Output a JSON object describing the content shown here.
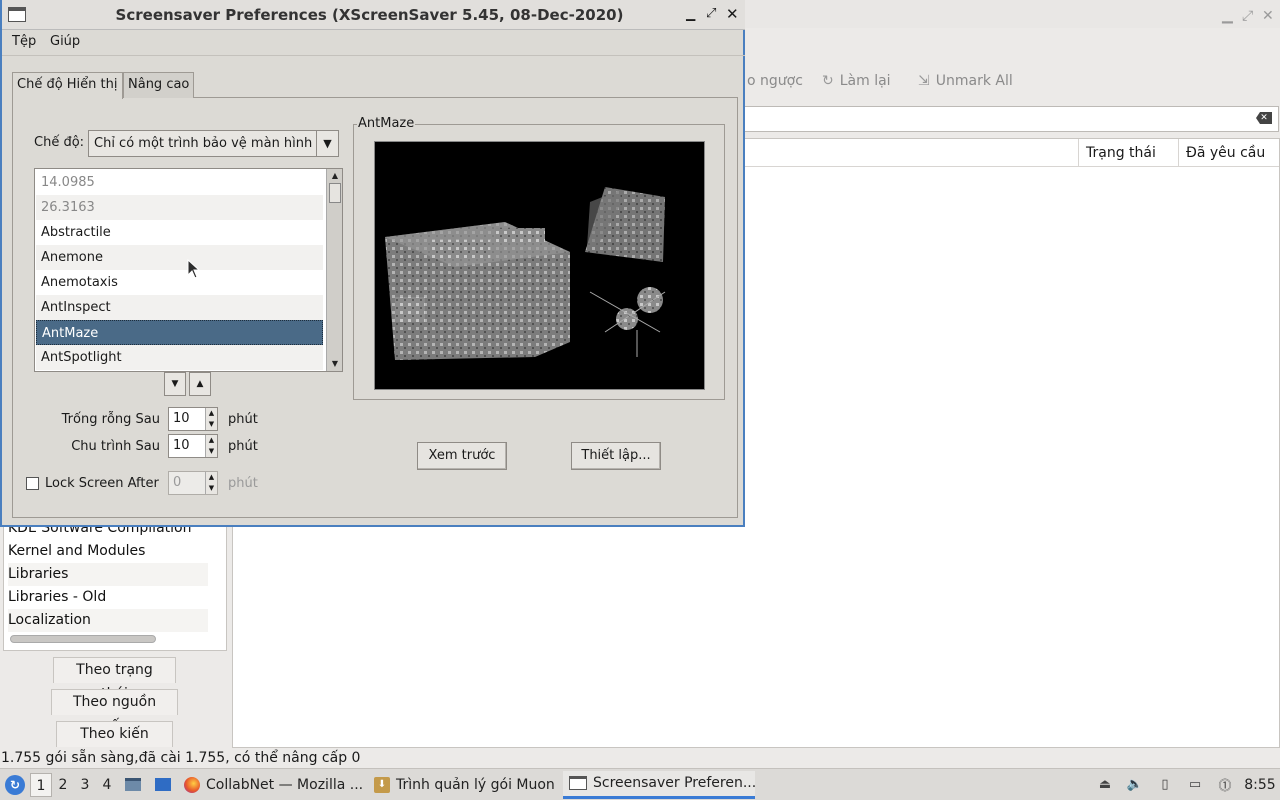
{
  "background_app": {
    "toolbar": {
      "undo_label": "o ngược",
      "redo_label": "Làm lại",
      "unmark_label": "Unmark All"
    },
    "table_headers": {
      "status": "Trạng thái",
      "requested": "Đã yêu cầu"
    },
    "categories": [
      "KDE Software Compilation",
      "Kernel and Modules",
      "Libraries",
      "Libraries - Old",
      "Localization"
    ],
    "filters": {
      "by_status": "Theo trạng thái",
      "by_origin": "Theo nguồn gốc",
      "by_arch": "Theo kiến trúc"
    },
    "status_text": "1.755 gói sẵn sàng,đã cài 1.755, có thể nâng cấp 0"
  },
  "dialog": {
    "title": "Screensaver Preferences  (XScreenSaver 5.45, 08-Dec-2020)",
    "menu": {
      "file": "Tệp",
      "help": "Giúp"
    },
    "tabs": {
      "display": "Chế độ Hiển thị",
      "advanced": "Nâng cao"
    },
    "mode_label": "Chế độ:",
    "mode_value": "Chỉ có một trình bảo vệ màn hình",
    "savers": [
      "14.0985",
      "26.3163",
      "Abstractile",
      "Anemone",
      "Anemotaxis",
      "AntInspect",
      "AntMaze",
      "AntSpotlight"
    ],
    "selected_saver": "AntMaze",
    "blank_after_label": "Trống rỗng Sau",
    "blank_after_value": "10",
    "cycle_after_label": "Chu trình Sau",
    "cycle_after_value": "10",
    "lock_label": "Lock Screen After",
    "lock_value": "0",
    "unit": "phút",
    "preview_title": "AntMaze",
    "preview_button": "Xem trước",
    "settings_button": "Thiết lập..."
  },
  "taskbar": {
    "workspaces": [
      "1",
      "2",
      "3",
      "4"
    ],
    "tasks": {
      "firefox": "CollabNet — Mozilla ...",
      "muon": "Trình quản lý gói Muon",
      "xscreensaver": "Screensaver Preferen..."
    },
    "clock": "8:55"
  }
}
